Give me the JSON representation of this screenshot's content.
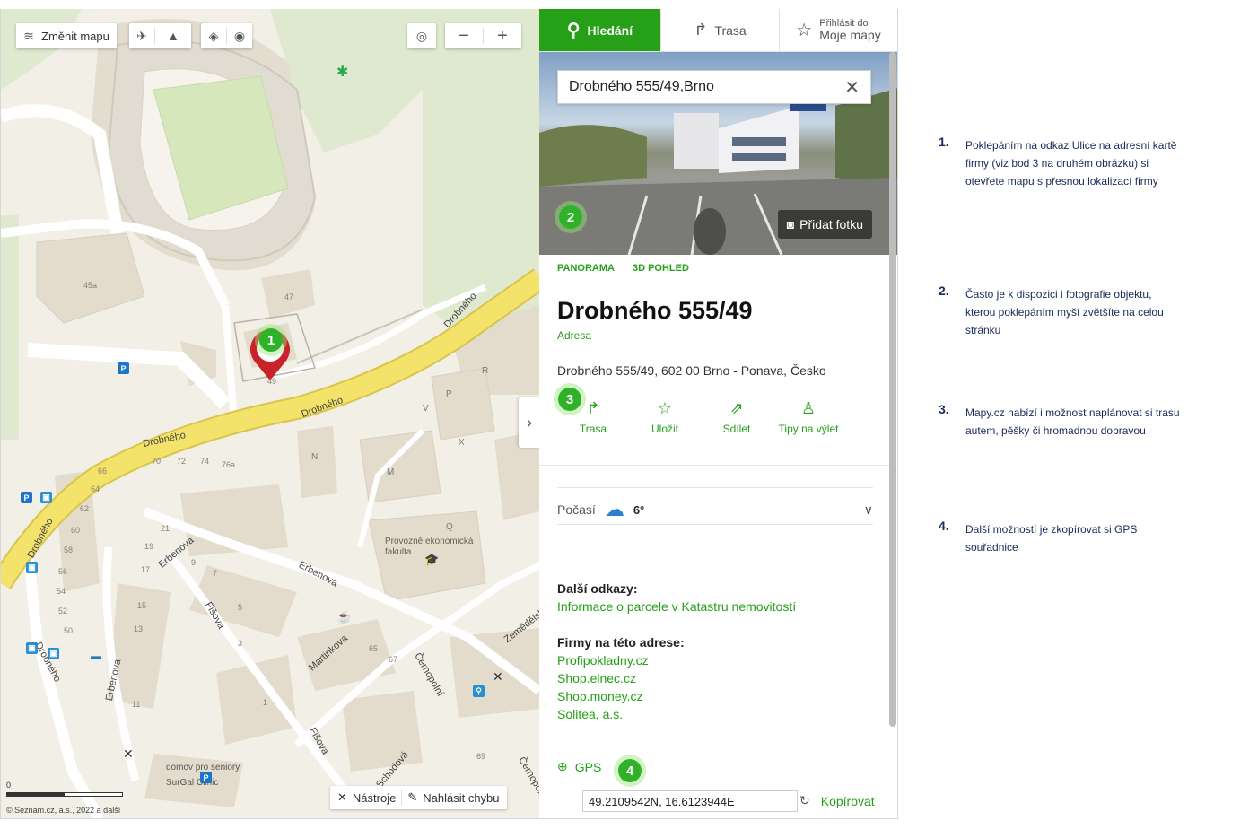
{
  "map": {
    "change_map_label": "Změnit mapu",
    "street_labels": [
      "Drobného",
      "Drobného",
      "Drobného",
      "Drobného",
      "Drobného",
      "Erbenova",
      "Erbenova",
      "Erbenova",
      "Fišova",
      "Fišova",
      "Martinkova",
      "Černopolní",
      "Černopolní",
      "Schodová",
      "Zemědělská"
    ],
    "building_numbers": [
      "45a",
      "47",
      "49",
      "70",
      "72",
      "74",
      "76a",
      "66",
      "64",
      "62",
      "60",
      "58",
      "56",
      "54",
      "52",
      "50",
      "21",
      "19",
      "17",
      "15",
      "13",
      "11",
      "9",
      "7",
      "5",
      "3",
      "1",
      "65",
      "67",
      "69"
    ],
    "block_letters": [
      "R",
      "P",
      "V",
      "X",
      "N",
      "M",
      "Q"
    ],
    "poi_school": "Provozně ekonomická fakulta",
    "poi_clinic_1": "domov pro seniory",
    "poi_clinic_2": "SurGal Clinic",
    "tools_label": "Nástroje",
    "report_label": "Nahlásit chybu",
    "copyright": "© Seznam.cz, a.s., 2022 a další",
    "scale_zero": "0",
    "marker_step": "1"
  },
  "panel": {
    "tabs": {
      "search": "Hledání",
      "route": "Trasa",
      "login_small": "Přihlásit do",
      "login_big": "Moje mapy"
    },
    "search_value": "Drobného 555/49,Brno",
    "add_photo": "Přidat fotku",
    "photo_step": "2",
    "tags": [
      "PANORAMA",
      "3D POHLED"
    ],
    "title": "Drobného 555/49",
    "type": "Adresa",
    "address": "Drobného 555/49, 602 00 Brno - Ponava, Česko",
    "actions_step": "3",
    "actions": [
      "Trasa",
      "Uložit",
      "Sdílet",
      "Tipy na výlet"
    ],
    "weather_label": "Počasí",
    "weather_temp": "6°",
    "more_links_heading": "Další odkazy:",
    "cadastre_link": "Informace o parcele v Katastru nemovitostí",
    "firms_heading": "Firmy na této adrese:",
    "firms": [
      "Profipokladny.cz",
      "Shop.elnec.cz",
      "Shop.money.cz",
      "Solitea, a.s."
    ],
    "gps_label": "GPS",
    "gps_step": "4",
    "coords": "49.2109542N, 16.6123944E",
    "copy_label": "Kopírovat"
  },
  "notes": [
    {
      "n": "1.",
      "text": "Poklepáním na odkaz Ulice na adresní kartě firmy (viz bod 3 na druhém obrázku) si otevřete mapu s přesnou lokalizací firmy"
    },
    {
      "n": "2.",
      "text": "Často je k dispozici i fotografie objektu, kterou poklepáním myší zvětšíte na celou stránku"
    },
    {
      "n": "3.",
      "text": "Mapy.cz nabízí i možnost naplánovat si trasu autem, pěšky či hromadnou dopravou"
    },
    {
      "n": "4.",
      "text": "Další možností je zkopírovat si GPS souřadnice"
    }
  ],
  "colors": {
    "accent": "#25a017",
    "road_yellow": "#f3e36a",
    "pin_red": "#c8222a",
    "note_text": "#1a2a5a"
  }
}
